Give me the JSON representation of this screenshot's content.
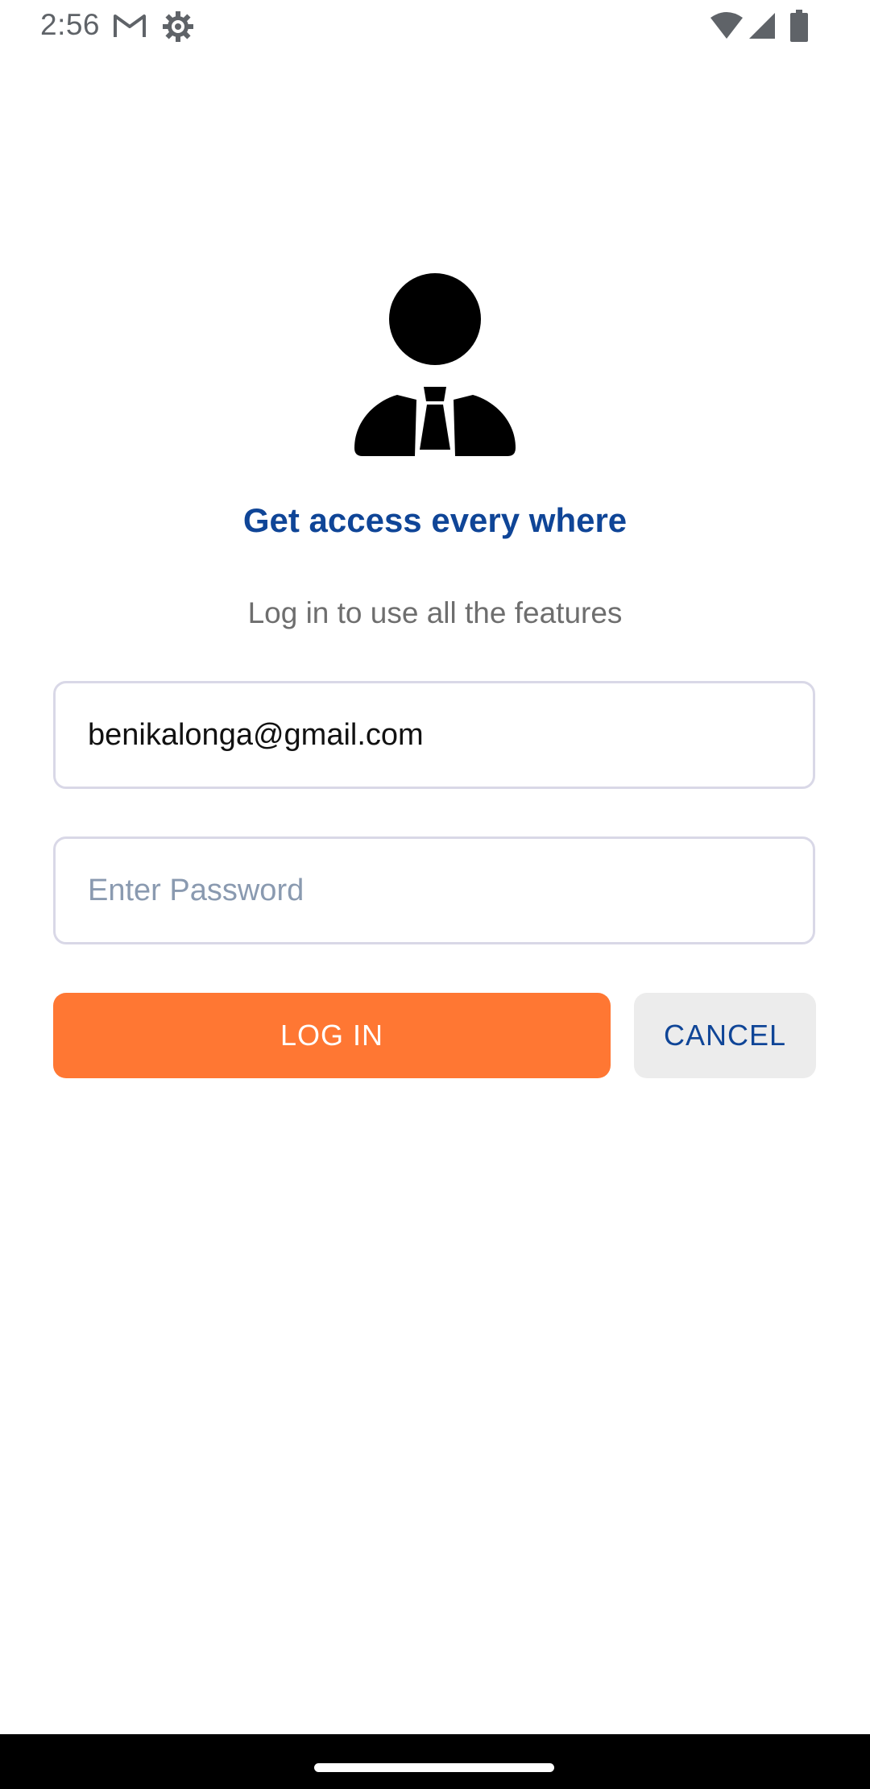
{
  "status_bar": {
    "time": "2:56",
    "icons": [
      "gmail-icon",
      "settings-icon",
      "wifi-icon",
      "signal-icon",
      "battery-icon"
    ]
  },
  "login": {
    "avatar_icon": "businessman-avatar-icon",
    "headline": "Get access every where",
    "subheadline": "Log in to use all the features",
    "email_value": "benikalonga@gmail.com",
    "password_placeholder": "Enter Password",
    "login_button": "LOG IN",
    "cancel_button": "CANCEL"
  },
  "colors": {
    "headline": "#0f4597",
    "login_button_bg": "#ff7733",
    "cancel_button_bg": "#ececec",
    "cancel_button_text": "#0f4597",
    "field_border": "#d9d8e7"
  }
}
